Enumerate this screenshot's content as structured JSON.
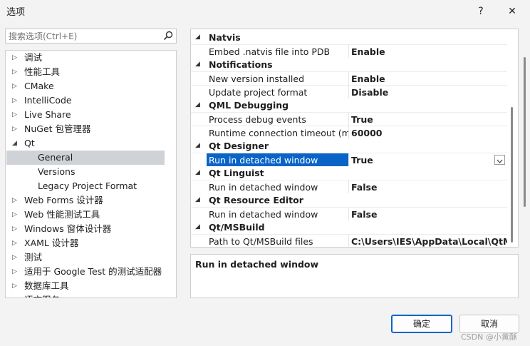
{
  "window": {
    "title": "选项",
    "help_glyph": "?",
    "close_glyph": "✕"
  },
  "search": {
    "placeholder": "搜索选项(Ctrl+E)"
  },
  "tree": {
    "items": [
      {
        "label": "调试",
        "arrow": "▷"
      },
      {
        "label": "性能工具",
        "arrow": "▷"
      },
      {
        "label": "CMake",
        "arrow": "▷"
      },
      {
        "label": "IntelliCode",
        "arrow": "▷"
      },
      {
        "label": "Live Share",
        "arrow": "▷"
      },
      {
        "label": "NuGet 包管理器",
        "arrow": "▷"
      },
      {
        "label": "Qt",
        "arrow": "◢"
      },
      {
        "label": "General",
        "arrow": ""
      },
      {
        "label": "Versions",
        "arrow": ""
      },
      {
        "label": "Legacy Project Format",
        "arrow": ""
      },
      {
        "label": "Web Forms 设计器",
        "arrow": "▷"
      },
      {
        "label": "Web 性能测试工具",
        "arrow": "▷"
      },
      {
        "label": "Windows 窗体设计器",
        "arrow": "▷"
      },
      {
        "label": "XAML 设计器",
        "arrow": "▷"
      },
      {
        "label": "测试",
        "arrow": "▷"
      },
      {
        "label": "适用于 Google Test 的测试适配器",
        "arrow": "▷"
      },
      {
        "label": "数据库工具",
        "arrow": "▷"
      },
      {
        "label": "语言服务",
        "arrow": "▷"
      }
    ]
  },
  "grid": {
    "collapse_glyph": "◢",
    "categories": [
      {
        "name": "Natvis",
        "props": [
          {
            "name": "Embed .natvis file into PDB",
            "value": "Enable"
          }
        ]
      },
      {
        "name": "Notifications",
        "props": [
          {
            "name": "New version installed",
            "value": "Enable"
          },
          {
            "name": "Update project format",
            "value": "Disable"
          }
        ]
      },
      {
        "name": "QML Debugging",
        "props": [
          {
            "name": "Process debug events",
            "value": "True"
          },
          {
            "name": "Runtime connection timeout (mse",
            "value": "60000"
          }
        ]
      },
      {
        "name": "Qt Designer",
        "props": [
          {
            "name": "Run in detached window",
            "value": "True"
          }
        ]
      },
      {
        "name": "Qt Linguist",
        "props": [
          {
            "name": "Run in detached window",
            "value": "False"
          }
        ]
      },
      {
        "name": "Qt Resource Editor",
        "props": [
          {
            "name": "Run in detached window",
            "value": "False"
          }
        ]
      },
      {
        "name": "Qt/MSBuild",
        "props": [
          {
            "name": "Path to Qt/MSBuild files",
            "value": "C:\\Users\\IES\\AppData\\Local\\QtMsBuild"
          }
        ]
      }
    ]
  },
  "description": {
    "title": "Run in detached window"
  },
  "buttons": {
    "ok": "确定",
    "cancel": "取消"
  },
  "watermark": "CSDN @小黄酥"
}
